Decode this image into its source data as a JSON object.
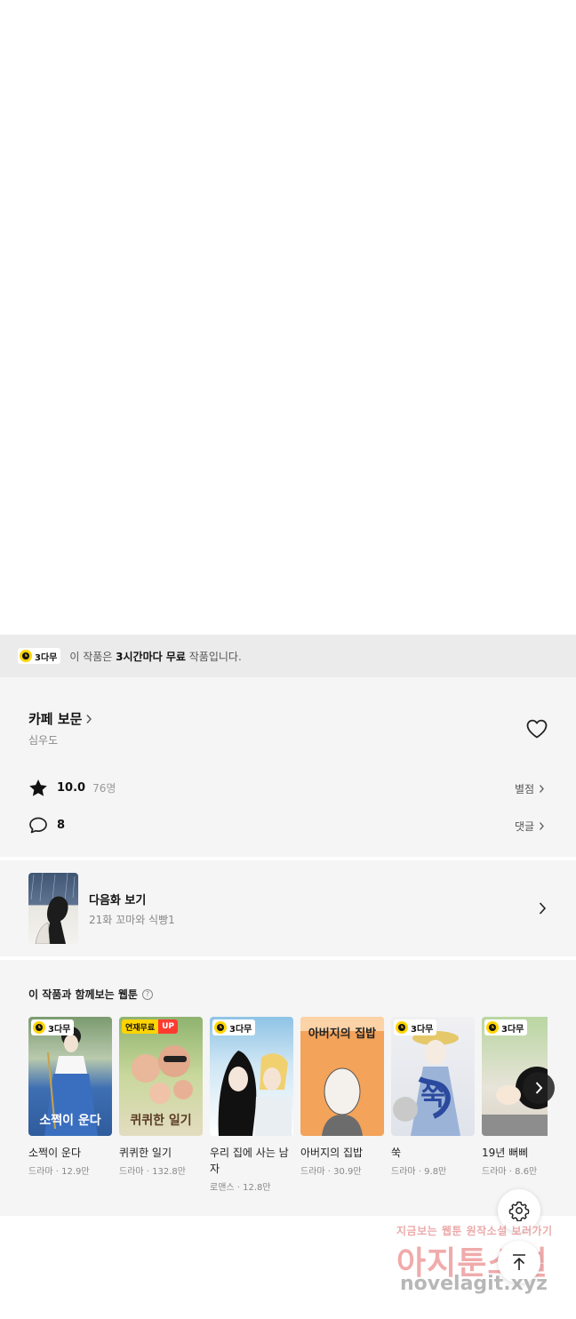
{
  "notice": {
    "badge": "3다무",
    "prefix": "이 작품은 ",
    "highlight": "3시간마다 무료",
    "suffix": " 작품입니다."
  },
  "work": {
    "title": "카페 보문",
    "author": "심우도",
    "rating": "10.0",
    "rating_count": "76명",
    "comment_count": "8",
    "rating_link": "별점",
    "comment_link": "댓글"
  },
  "next_episode": {
    "label": "다음화 보기",
    "subtitle": "21화 꼬마와 식빵1"
  },
  "recommendations": {
    "title": "이 작품과 함께보는 웹툰",
    "help": "?",
    "items": [
      {
        "title": "소쩍이 운다",
        "genre": "드라마",
        "views": "12.9만",
        "badge": "3다무",
        "cover_text": "소쩍이 운다"
      },
      {
        "title": "퀴퀴한 일기",
        "genre": "드라마",
        "views": "132.8만",
        "badge_left": "연재무료",
        "badge_right": "UP",
        "cover_text": "퀴퀴한 일기"
      },
      {
        "title": "우리 집에 사는 남자",
        "genre": "로맨스",
        "views": "12.8만",
        "badge": "3다무",
        "cover_text": "우리 집에 사는 남자"
      },
      {
        "title": "아버지의 집밥",
        "genre": "드라마",
        "views": "30.9만",
        "badge": "",
        "cover_text": "아버지의 집밥"
      },
      {
        "title": "쑥",
        "genre": "드라마",
        "views": "9.8만",
        "badge": "3다무",
        "cover_text": "쑥"
      },
      {
        "title": "19년 뻐삐",
        "genre": "드라마",
        "views": "8.6만",
        "badge": "3다무",
        "cover_text": ""
      }
    ],
    "separator": " · "
  },
  "watermark": {
    "line1": "지금보는 웹툰 원작소설 보러가기",
    "line2": "아지툰소설",
    "line3": "novelagit.xyz"
  },
  "colors": {
    "accent_yellow": "#ffd400",
    "up_red": "#ff3b30"
  }
}
